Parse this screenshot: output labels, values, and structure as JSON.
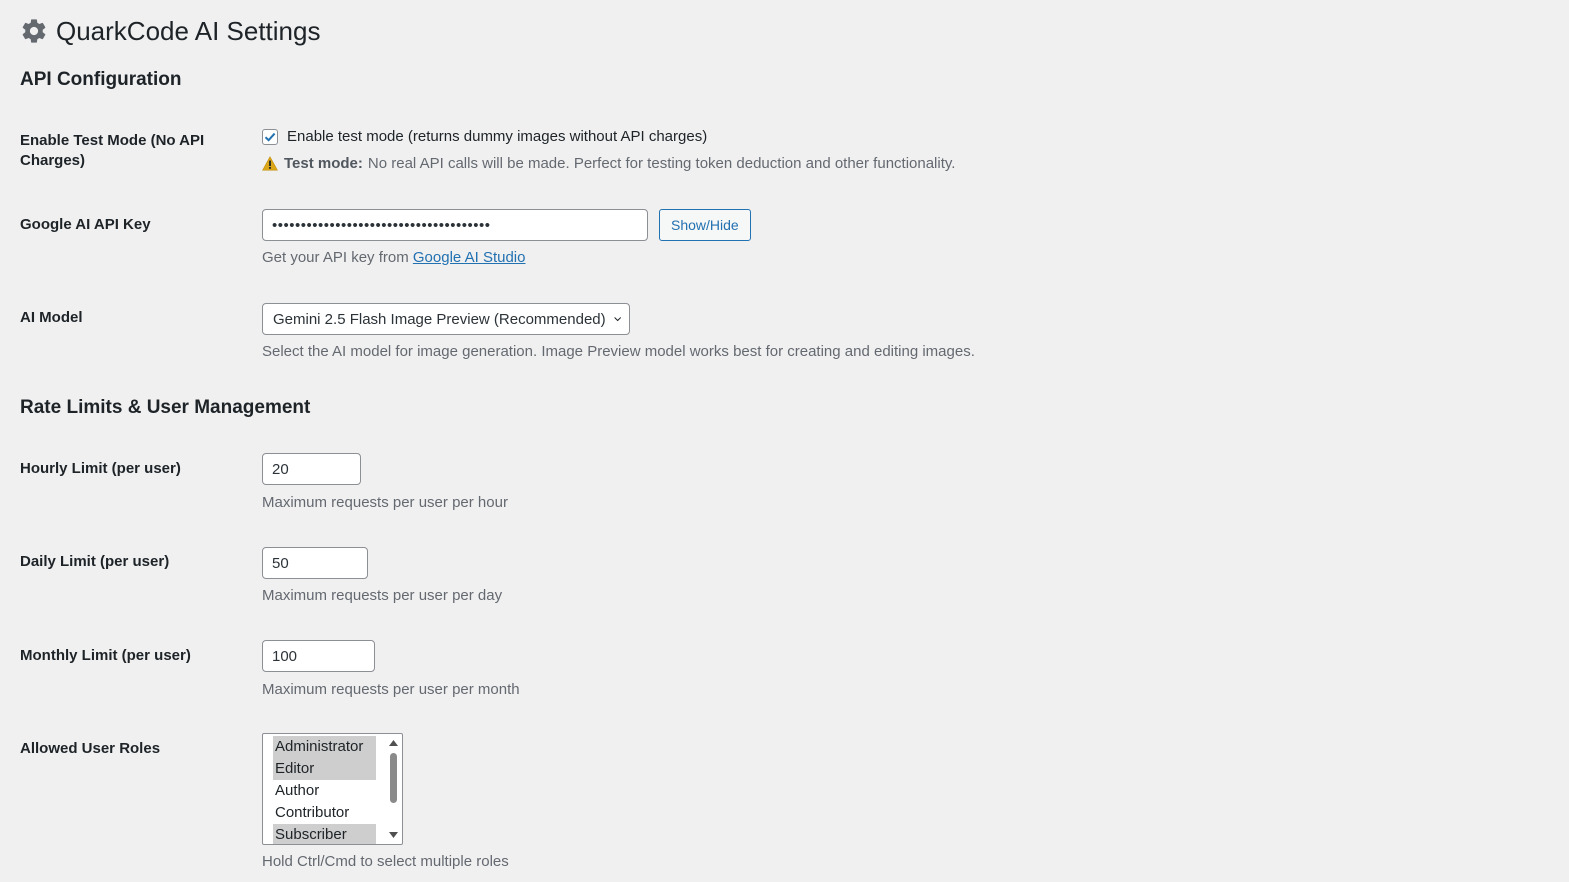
{
  "page": {
    "title": "QuarkCode AI Settings",
    "icon": "gear-icon"
  },
  "sections": {
    "api": "API Configuration",
    "rate": "Rate Limits & User Management"
  },
  "test_mode": {
    "label": "Enable Test Mode (No API Charges)",
    "checkbox_label": "Enable test mode (returns dummy images without API charges)",
    "checked": true,
    "warning_bold": "Test mode:",
    "warning_text": "No real API calls will be made. Perfect for testing token deduction and other functionality."
  },
  "api_key": {
    "label": "Google AI API Key",
    "value": "••••••••••••••••••••••••••••••••••••••",
    "button": "Show/Hide",
    "desc_prefix": "Get your API key from",
    "desc_link": "Google AI Studio"
  },
  "model": {
    "label": "AI Model",
    "selected": "Gemini 2.5 Flash Image Preview (Recommended)",
    "desc": "Select the AI model for image generation. Image Preview model works best for creating and editing images."
  },
  "hourly": {
    "label": "Hourly Limit (per user)",
    "value": "20",
    "desc": "Maximum requests per user per hour"
  },
  "daily": {
    "label": "Daily Limit (per user)",
    "value": "50",
    "desc": "Maximum requests per user per day"
  },
  "monthly": {
    "label": "Monthly Limit (per user)",
    "value": "100",
    "desc": "Maximum requests per user per month"
  },
  "roles": {
    "label": "Allowed User Roles",
    "options": [
      {
        "label": "Administrator",
        "selected": true
      },
      {
        "label": "Editor",
        "selected": true
      },
      {
        "label": "Author",
        "selected": false
      },
      {
        "label": "Contributor",
        "selected": false
      },
      {
        "label": "Subscriber",
        "selected": true
      }
    ],
    "desc": "Hold Ctrl/Cmd to select multiple roles"
  },
  "colors": {
    "background": "#f0f0f1",
    "accent": "#2271b1",
    "warning": "#dba617",
    "selected_option": "#cecece"
  }
}
